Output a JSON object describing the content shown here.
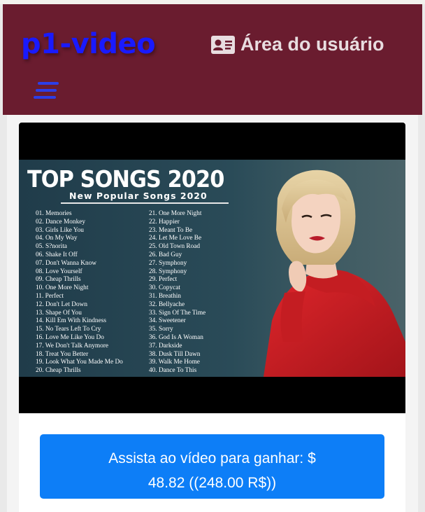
{
  "header": {
    "brand": "p1-video",
    "user_area_label": "Área do usuário",
    "user_area_icon": "id-card-icon",
    "menu_icon": "hamburger-menu-icon",
    "background_color": "#6a1c2f",
    "brand_color": "#1a1aff"
  },
  "video": {
    "thumbnail": {
      "title": "TOP SONGS 2020",
      "subtitle": "New Popular Songs 2020",
      "songs_col1": [
        "01. Memories",
        "02. Dance Monkey",
        "03. Girls Like You",
        "04. On My Way",
        "05. S?norita",
        "06. Shake It Off",
        "07. Don't Wanna Know",
        "08. Love Yourself",
        "09. Cheap Thrills",
        "10. One More Night",
        "11. Perfect",
        "12. Don't Let Down",
        "13. Shape Of  You",
        "14. Kill Em With Kindness",
        "15. No Tears Left To Cry",
        "16. Love Me Like You Do",
        "17. We Don't Talk Anymore",
        "18. Treat You Better",
        "19. Look What You Made Me Do",
        "20. Cheap Thrills"
      ],
      "songs_col2": [
        "21. One More Night",
        "22. Happier",
        "23. Meant To Be",
        "24. Let Me Love Be",
        "25. Old Town Road",
        "26. Bad Guy",
        "27. Symphony",
        "28. Symphony",
        "29. Perfect",
        "30. Copycat",
        "31. Breathin",
        "32. Bellyache",
        "33. Sign Of The Time",
        "34. Sweetener",
        "35. Sorry",
        "36. God Is A Woman",
        "37. Darkside",
        "38. Dusk Till Dawn",
        "39. Walk Me Home",
        "40. Dance To This"
      ]
    }
  },
  "cta": {
    "line1": "Assista ao vídeo para ganhar: $",
    "line2": "48.82 ((248.00 R$))",
    "color": "#0d7ef7"
  }
}
